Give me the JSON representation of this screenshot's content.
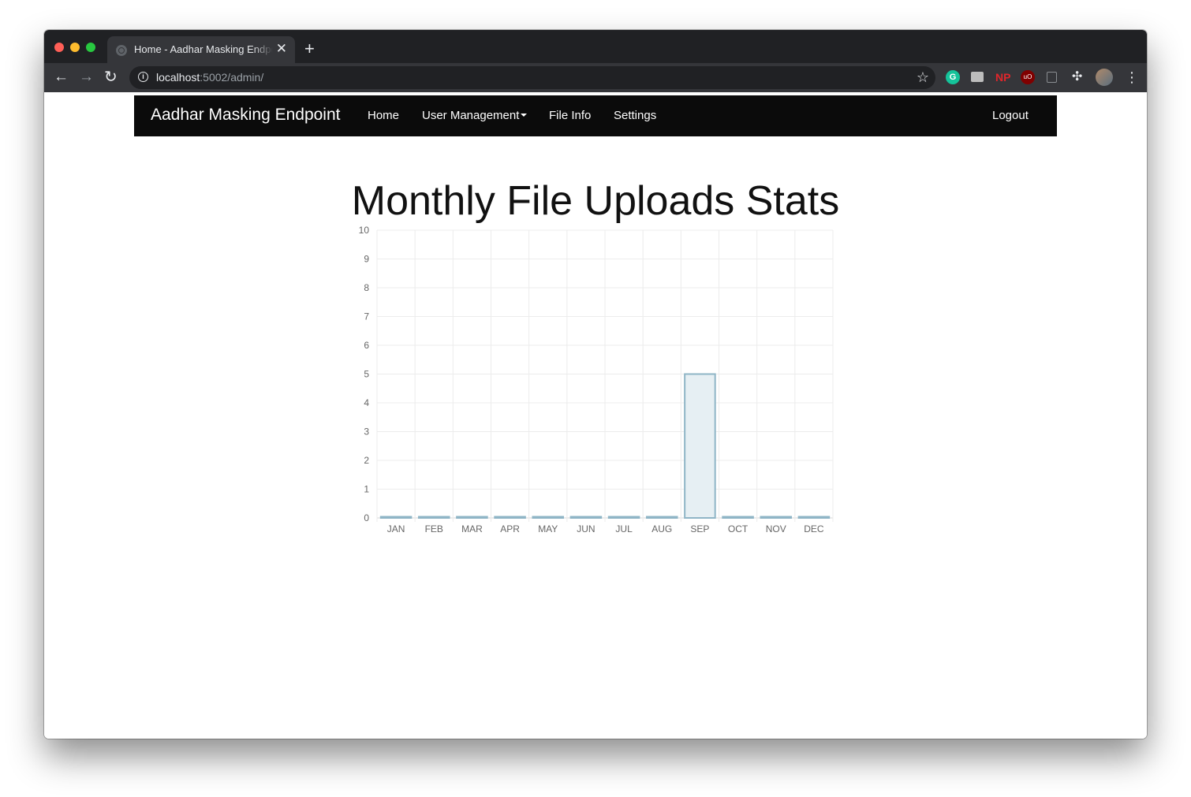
{
  "browser": {
    "tab_title": "Home - Aadhar Masking Endpoint",
    "tab_close": "✕",
    "new_tab": "+",
    "url_host": "localhost",
    "url_rest": ":5002/admin/",
    "extensions": [
      "grammarly-icon",
      "mail-icon",
      "np-icon",
      "ublock-icon",
      "copy-icon",
      "puzzle-icon",
      "avatar",
      "menu-icon"
    ],
    "grammarly_glyph": "G",
    "np_label": "NP",
    "ublock_label": "uO"
  },
  "navbar": {
    "brand": "Aadhar Masking Endpoint",
    "home": "Home",
    "user_management": "User Management",
    "file_info": "File Info",
    "settings": "Settings",
    "logout": "Logout",
    "color": "#0b0b0b"
  },
  "page": {
    "heading": "Monthly File Uploads Stats"
  },
  "chart_data": {
    "type": "bar",
    "categories": [
      "JAN",
      "FEB",
      "MAR",
      "APR",
      "MAY",
      "JUN",
      "JUL",
      "AUG",
      "SEP",
      "OCT",
      "NOV",
      "DEC"
    ],
    "values": [
      0,
      0,
      0,
      0,
      0,
      0,
      0,
      0,
      5,
      0,
      0,
      0
    ],
    "ylim": [
      0,
      10
    ],
    "yticks": [
      0,
      1,
      2,
      3,
      4,
      5,
      6,
      7,
      8,
      9,
      10
    ],
    "grid": true,
    "legend": "none",
    "bar_fill": "#e6eff3",
    "bar_stroke": "#8fb5c6"
  }
}
